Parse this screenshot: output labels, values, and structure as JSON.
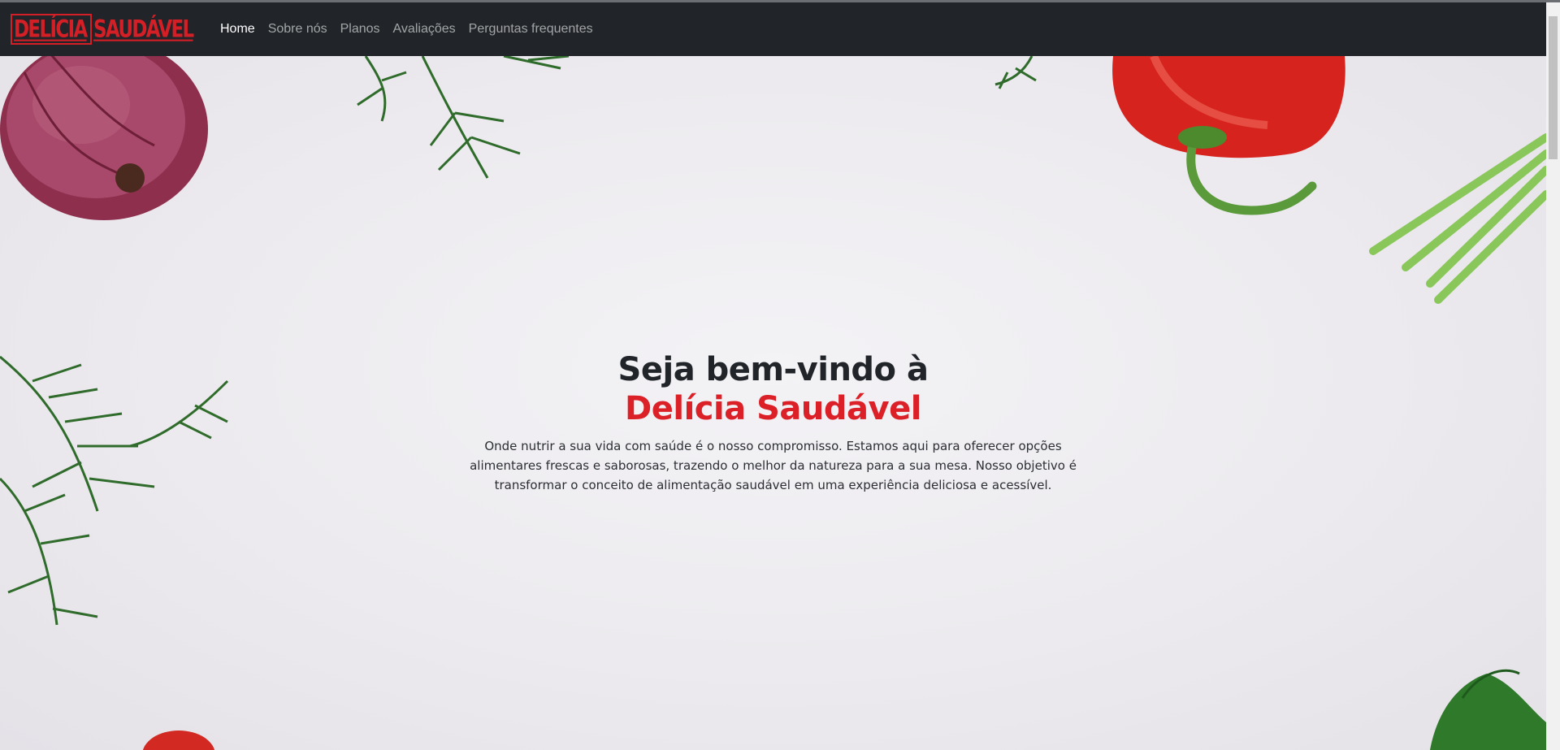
{
  "brand": {
    "part1": "DELÍCIA",
    "part2": "SAUDÁVEL",
    "color": "#d51f26"
  },
  "nav": {
    "items": [
      {
        "label": "Home",
        "active": true
      },
      {
        "label": "Sobre nós",
        "active": false
      },
      {
        "label": "Planos",
        "active": false
      },
      {
        "label": "Avaliações",
        "active": false
      },
      {
        "label": "Perguntas frequentes",
        "active": false
      }
    ]
  },
  "hero": {
    "title_line1": "Seja bem-vindo à",
    "title_line2": "Delícia Saudável",
    "description": "Onde nutrir a sua vida com saúde é o nosso compromisso. Estamos aqui para oferecer opções alimentares frescas e saborosas, trazendo o melhor da natureza para a sua mesa. Nosso objetivo é transformar o conceito de alimentação saudável em uma experiência deliciosa e acessível.",
    "background": "vegetables-on-white-table",
    "accent_color": "#dc2027"
  }
}
